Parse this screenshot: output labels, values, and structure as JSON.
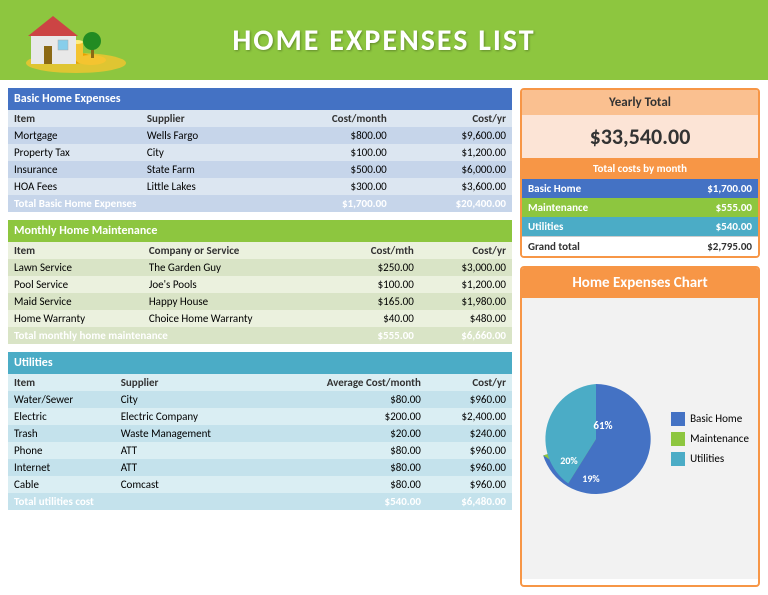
{
  "header": {
    "title": "HOME EXPENSES LIST"
  },
  "basic": {
    "section_title": "Basic Home Expenses",
    "columns": [
      "Item",
      "Supplier",
      "Cost/month",
      "Cost/yr"
    ],
    "rows": [
      [
        "Mortgage",
        "Wells Fargo",
        "$800.00",
        "$9,600.00"
      ],
      [
        "Property Tax",
        "City",
        "$100.00",
        "$1,200.00"
      ],
      [
        "Insurance",
        "State Farm",
        "$500.00",
        "$6,000.00"
      ],
      [
        "HOA Fees",
        "Little Lakes",
        "$300.00",
        "$3,600.00"
      ]
    ],
    "total_label": "Total Basic Home Expenses",
    "total_month": "$1,700.00",
    "total_yr": "$20,400.00"
  },
  "maintenance": {
    "section_title": "Monthly Home Maintenance",
    "columns": [
      "Item",
      "Company or Service",
      "Cost/mth",
      "Cost/yr"
    ],
    "rows": [
      [
        "Lawn Service",
        "The Garden Guy",
        "$250.00",
        "$3,000.00"
      ],
      [
        "Pool Service",
        "Joe's Pools",
        "$100.00",
        "$1,200.00"
      ],
      [
        "Maid Service",
        "Happy House",
        "$165.00",
        "$1,980.00"
      ],
      [
        "Home Warranty",
        "Choice Home Warranty",
        "$40.00",
        "$480.00"
      ]
    ],
    "total_label": "Total monthly home maintenance",
    "total_month": "$555.00",
    "total_yr": "$6,660.00"
  },
  "utilities": {
    "section_title": "Utilities",
    "columns": [
      "Item",
      "Supplier",
      "Average Cost/month",
      "Cost/yr"
    ],
    "rows": [
      [
        "Water/Sewer",
        "City",
        "$80.00",
        "$960.00"
      ],
      [
        "Electric",
        "Electric Company",
        "$200.00",
        "$2,400.00"
      ],
      [
        "Trash",
        "Waste Management",
        "$20.00",
        "$240.00"
      ],
      [
        "Phone",
        "ATT",
        "$80.00",
        "$960.00"
      ],
      [
        "Internet",
        "ATT",
        "$80.00",
        "$960.00"
      ],
      [
        "Cable",
        "Comcast",
        "$80.00",
        "$960.00"
      ]
    ],
    "total_label": "Total utilities cost",
    "total_month": "$540.00",
    "total_yr": "$6,480.00"
  },
  "yearly": {
    "title": "Yearly Total",
    "value": "$33,540.00",
    "subtitle": "Total costs by month"
  },
  "costs_by_month": {
    "rows": [
      {
        "label": "Basic Home",
        "value": "$1,700.00",
        "type": "basic"
      },
      {
        "label": "Maintenance",
        "value": "$555.00",
        "type": "maint"
      },
      {
        "label": "Utilities",
        "value": "$540.00",
        "type": "util"
      },
      {
        "label": "Grand total",
        "value": "$2,795.00",
        "type": "grand"
      }
    ]
  },
  "chart": {
    "title": "Home Expenses Chart",
    "segments": [
      {
        "label": "Basic Home",
        "percent": 61,
        "color": "#4472c4"
      },
      {
        "label": "Maintenance",
        "percent": 20,
        "color": "#8dc63f"
      },
      {
        "label": "Utilities",
        "percent": 19,
        "color": "#4bacc6"
      }
    ]
  }
}
